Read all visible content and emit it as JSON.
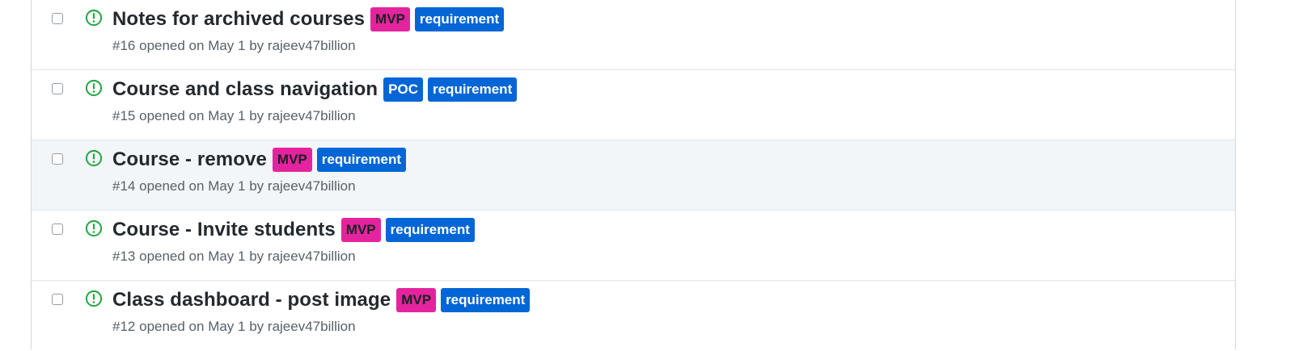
{
  "colors": {
    "open_icon": "#28a745",
    "mvp_bg": "#e4249e",
    "mvp_text": "#1b1f23",
    "poc_bg": "#0366d6",
    "requirement_bg": "#0366d6",
    "label_light_text": "#ffffff"
  },
  "issues": [
    {
      "title": "Notes for archived courses",
      "status_icon": "issue-opened-icon",
      "labels": [
        {
          "text": "MVP",
          "bg": "#e4249e",
          "fg": "#1b1f23"
        },
        {
          "text": "requirement",
          "bg": "#0366d6",
          "fg": "#ffffff"
        }
      ],
      "number": "#16",
      "opened_text": "opened on May 1 by",
      "author": "rajeev47billion",
      "hover": false
    },
    {
      "title": "Course and class navigation",
      "status_icon": "issue-opened-icon",
      "labels": [
        {
          "text": "POC",
          "bg": "#0366d6",
          "fg": "#ffffff"
        },
        {
          "text": "requirement",
          "bg": "#0366d6",
          "fg": "#ffffff"
        }
      ],
      "number": "#15",
      "opened_text": "opened on May 1 by",
      "author": "rajeev47billion",
      "hover": false
    },
    {
      "title": "Course - remove",
      "status_icon": "issue-opened-icon",
      "labels": [
        {
          "text": "MVP",
          "bg": "#e4249e",
          "fg": "#1b1f23"
        },
        {
          "text": "requirement",
          "bg": "#0366d6",
          "fg": "#ffffff"
        }
      ],
      "number": "#14",
      "opened_text": "opened on May 1 by",
      "author": "rajeev47billion",
      "hover": true
    },
    {
      "title": "Course - Invite students",
      "status_icon": "issue-opened-icon",
      "labels": [
        {
          "text": "MVP",
          "bg": "#e4249e",
          "fg": "#1b1f23"
        },
        {
          "text": "requirement",
          "bg": "#0366d6",
          "fg": "#ffffff"
        }
      ],
      "number": "#13",
      "opened_text": "opened on May 1 by",
      "author": "rajeev47billion",
      "hover": false
    },
    {
      "title": "Class dashboard - post image",
      "status_icon": "issue-opened-icon",
      "labels": [
        {
          "text": "MVP",
          "bg": "#e4249e",
          "fg": "#1b1f23"
        },
        {
          "text": "requirement",
          "bg": "#0366d6",
          "fg": "#ffffff"
        }
      ],
      "number": "#12",
      "opened_text": "opened on May 1 by",
      "author": "rajeev47billion",
      "hover": false
    }
  ]
}
